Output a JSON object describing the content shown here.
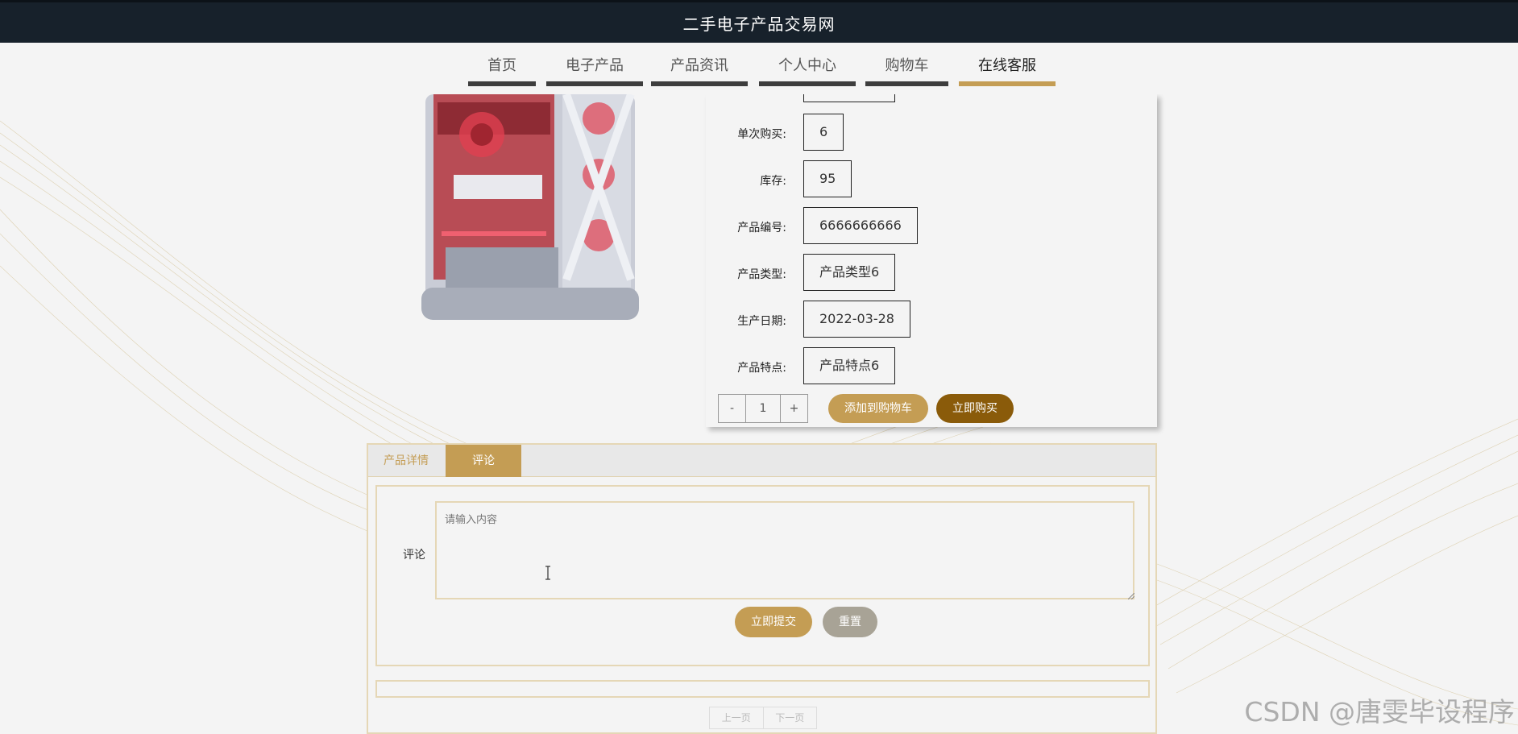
{
  "site": {
    "title": "二手电子产品交易网"
  },
  "nav": [
    {
      "label": "首页"
    },
    {
      "label": "电子产品"
    },
    {
      "label": "产品资讯"
    },
    {
      "label": "个人中心"
    },
    {
      "label": "购物车"
    },
    {
      "label": "在线客服",
      "active": true
    }
  ],
  "product": {
    "fields": [
      {
        "label": "单次购买:",
        "value": "6"
      },
      {
        "label": "库存:",
        "value": "95"
      },
      {
        "label": "产品编号:",
        "value": "6666666666"
      },
      {
        "label": "产品类型:",
        "value": "产品类型6"
      },
      {
        "label": "生产日期:",
        "value": "2022-03-28"
      },
      {
        "label": "产品特点:",
        "value": "产品特点6"
      }
    ],
    "quantity": {
      "minus": "-",
      "value": "1",
      "plus": "+"
    },
    "add_to_cart": "添加到购物车",
    "buy_now": "立即购买"
  },
  "tabs": [
    {
      "label": "产品详情"
    },
    {
      "label": "评论",
      "active": true
    }
  ],
  "comment": {
    "label": "评论",
    "placeholder": "请输入内容",
    "submit": "立即提交",
    "reset": "重置"
  },
  "pager": {
    "prev": "上一页",
    "next": "下一页"
  },
  "watermark": "CSDN @唐雯毕设程序",
  "colors": {
    "accent": "#c49d54",
    "dark_buy": "#8a5b0a",
    "header_bg": "#17212b"
  }
}
